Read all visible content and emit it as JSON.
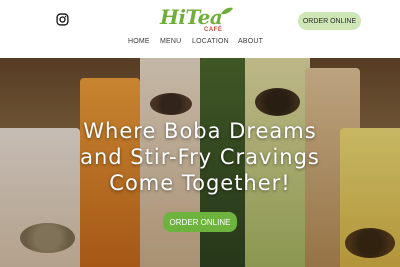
{
  "header": {
    "social_icon": "instagram-icon",
    "logo_text": "HiTea",
    "logo_sub": "CAFÉ",
    "order_button": "ORDER ONLINE"
  },
  "nav": {
    "items": [
      {
        "label": "HOME"
      },
      {
        "label": "MENU"
      },
      {
        "label": "LOCATION"
      },
      {
        "label": "ABOUT"
      }
    ]
  },
  "hero": {
    "title_line1": "Where Boba Dreams",
    "title_line2": "and Stir-Fry Cravings",
    "title_line3": "Come Together!",
    "order_button": "ORDER ONLINE"
  },
  "colors": {
    "brand_green": "#6fae3a",
    "button_green": "#6fb33f",
    "button_light": "#cfe6b6",
    "accent_red": "#d14b3c"
  }
}
